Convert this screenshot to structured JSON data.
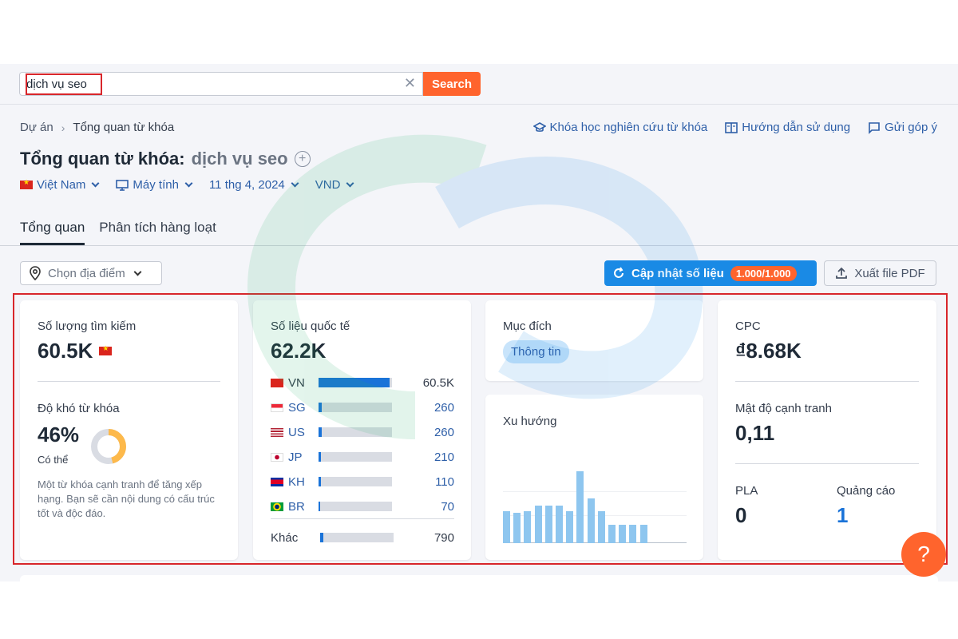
{
  "search": {
    "value": "dịch vụ seo",
    "button_label": "Search"
  },
  "breadcrumb": {
    "items": [
      "Dự án",
      "Tổng quan từ khóa"
    ]
  },
  "toplinks": [
    "Khóa học nghiên cứu từ khóa",
    "Hướng dẫn sử dụng",
    "Gửi góp ý"
  ],
  "page": {
    "title_prefix": "Tổng quan từ khóa:",
    "keyword": "dịch vụ seo"
  },
  "filters": {
    "country": "Việt Nam",
    "device": "Máy tính",
    "date": "11 thg 4, 2024",
    "currency": "VND"
  },
  "tabs": [
    "Tổng quan",
    "Phân tích hàng loạt"
  ],
  "location_select": {
    "placeholder": "Chọn địa điểm"
  },
  "update_button": {
    "label": "Cập nhật số liệu",
    "quota": "1.000/1.000"
  },
  "export_button": {
    "label": "Xuất file PDF"
  },
  "volume_card": {
    "label": "Số lượng tìm kiếm",
    "value": "60.5K",
    "difficulty_label": "Độ khó từ khóa",
    "difficulty_value": "46%",
    "difficulty_percent": 46,
    "difficulty_level": "Có thể",
    "difficulty_desc": "Một từ khóa cạnh tranh để tăng xếp hạng. Bạn sẽ cần nội dung có cấu trúc tốt và độc đáo.",
    "difficulty_color": "#fdb94b"
  },
  "global_card": {
    "label": "Số liệu quốc tế",
    "value": "62.2K",
    "countries": [
      {
        "code": "VN",
        "value": "60.5K",
        "share": 0.97
      },
      {
        "code": "SG",
        "value": "260",
        "share": 0.04
      },
      {
        "code": "US",
        "value": "260",
        "share": 0.04
      },
      {
        "code": "JP",
        "value": "210",
        "share": 0.035
      },
      {
        "code": "KH",
        "value": "110",
        "share": 0.03
      },
      {
        "code": "BR",
        "value": "70",
        "share": 0.025
      }
    ],
    "other": {
      "label": "Khác",
      "value": "790",
      "share": 0.04
    }
  },
  "intent_card": {
    "label": "Mục đích",
    "tag": "Thông tin"
  },
  "trend_card": {
    "label": "Xu hướng",
    "values": [
      0.45,
      0.42,
      0.45,
      0.52,
      0.52,
      0.52,
      0.45,
      1.0,
      0.62,
      0.45,
      0.26,
      0.26,
      0.26,
      0.26
    ]
  },
  "cpc_card": {
    "cpc_label": "CPC",
    "cpc_value": "₫8.68K",
    "competition_label": "Mật độ cạnh tranh",
    "competition_value": "0,11",
    "pla_label": "PLA",
    "pla_value": "0",
    "ads_label": "Quảng cáo",
    "ads_value": "1"
  },
  "help_button": {
    "label": "?"
  },
  "colors": {
    "accent_orange": "#ff642d",
    "primary_blue": "#1a8ae5",
    "highlight_red": "#d8262b"
  }
}
